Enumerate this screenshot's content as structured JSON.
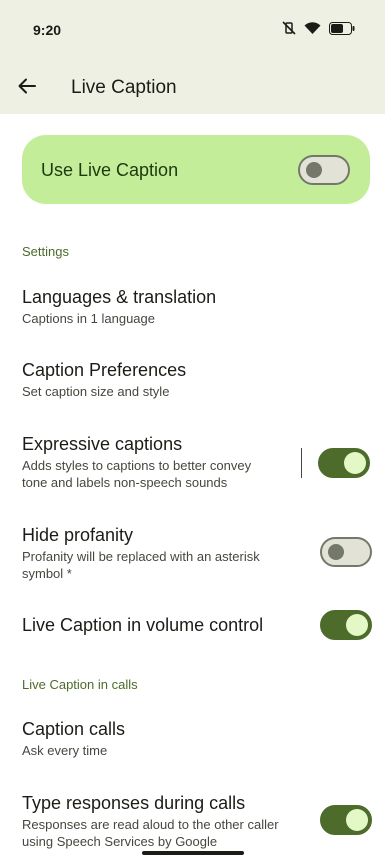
{
  "status_bar": {
    "time": "9:20"
  },
  "app_bar": {
    "title": "Live Caption"
  },
  "main_toggle": {
    "label": "Use Live Caption",
    "checked": false
  },
  "sections": {
    "settings_header": "Settings",
    "calls_header": "Live Caption in calls"
  },
  "items": {
    "languages": {
      "title": "Languages & translation",
      "subtitle": "Captions in 1 language"
    },
    "preferences": {
      "title": "Caption Preferences",
      "subtitle": "Set caption size and style"
    },
    "expressive": {
      "title": "Expressive captions",
      "subtitle_line1": "Adds styles to captions to better convey",
      "subtitle_line2": "tone and labels non-speech sounds",
      "checked": true
    },
    "profanity": {
      "title": "Hide profanity",
      "subtitle_line1": "Profanity will be replaced with an asterisk",
      "subtitle_line2": "symbol *",
      "checked": false
    },
    "volume": {
      "title": "Live Caption in volume control",
      "checked": true
    },
    "caption_calls": {
      "title": "Caption calls",
      "subtitle": "Ask every time"
    },
    "type_responses": {
      "title": "Type responses during calls",
      "subtitle_line1": "Responses are read aloud to the other caller",
      "subtitle_line2": "using Speech Services by Google",
      "checked": true
    }
  },
  "icons": {
    "back": "arrow-back-icon",
    "mute": "vibrate-mute-icon",
    "wifi": "wifi-icon",
    "battery": "battery-icon"
  },
  "colors": {
    "accent": "#4d6b2a",
    "card": "#c4ed9a",
    "topbar": "#eef0e4"
  }
}
